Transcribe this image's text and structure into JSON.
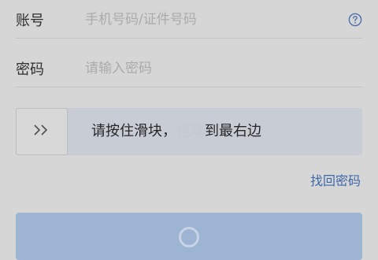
{
  "account": {
    "label": "账号",
    "placeholder": "手机号码/证件号码",
    "value": "",
    "help_icon": "question-circle-icon"
  },
  "password": {
    "label": "密码",
    "placeholder": "请输入密码",
    "value": ""
  },
  "slider": {
    "text_part1": "请按住滑块，",
    "text_part2": "拖动",
    "text_part3": "到最右边",
    "handle_icon": "double-chevron-right-icon"
  },
  "forgot_password": "找回密码",
  "login_button": {
    "icon": "login-icon"
  },
  "colors": {
    "link": "#3f68a8",
    "button": "#9db4d2",
    "slider_track": "#c8ccd5"
  }
}
